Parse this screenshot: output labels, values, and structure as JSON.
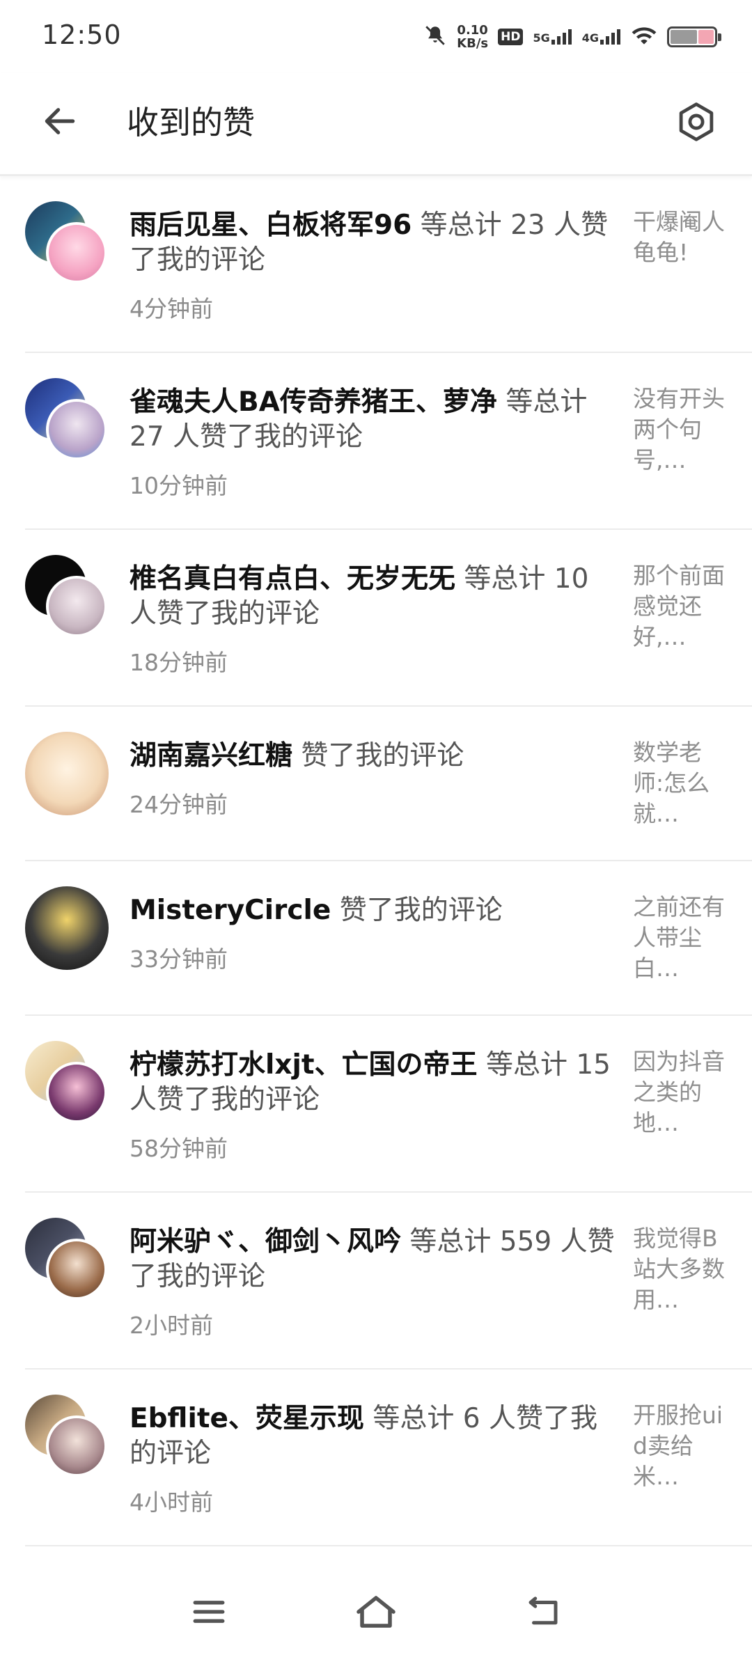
{
  "status": {
    "time": "12:50",
    "net_speed_value": "0.10",
    "net_speed_unit": "KB/s",
    "hd_label": "HD",
    "sig1_label": "5G",
    "sig2_label": "4G"
  },
  "header": {
    "title": "收到的赞"
  },
  "items": [
    {
      "names": "雨后见星、白板将军96",
      "action": " 等总计 23 人赞了我的评论",
      "time": "4分钟前",
      "preview": "干爆阉人龟龟!",
      "avatar_colors": [
        "#2e6b8a",
        "#f5a3c2"
      ]
    },
    {
      "names": "雀魂夫人BA传奇养猪王、萝净",
      "action": " 等总计 27 人赞了我的评论",
      "time": "10分钟前",
      "preview": "没有开头两个句号,…",
      "avatar_colors": [
        "#3b5bb5",
        "#b9a3c9"
      ]
    },
    {
      "names": "椎名真白有点白、无岁无旡",
      "action": " 等总计 10 人赞了我的评论",
      "time": "18分钟前",
      "preview": "那个前面感觉还好,…",
      "avatar_colors": [
        "#0a0a0a",
        "#c9b7c2"
      ]
    },
    {
      "names": "湖南嘉兴红糖",
      "action": " 赞了我的评论",
      "time": "24分钟前",
      "preview": "数学老师:怎么就…",
      "avatar_colors": [
        "#f3d8b7"
      ]
    },
    {
      "names": "MisteryCircle",
      "action": " 赞了我的评论",
      "time": "33分钟前",
      "preview": "之前还有人带尘白…",
      "avatar_colors": [
        "#1c1c1c"
      ]
    },
    {
      "names": "柠檬苏打水lxjt、亡国の帝王",
      "action": " 等总计 15 人赞了我的评论",
      "time": "58分钟前",
      "preview": "因为抖音之类的地…",
      "avatar_colors": [
        "#e8cfa0",
        "#7a3a6e"
      ]
    },
    {
      "names": "阿米驴ヾ、御剑丶风吟",
      "action": " 等总计 559 人赞了我的评论",
      "time": "2小时前",
      "preview": "我觉得B站大多数用…",
      "avatar_colors": [
        "#4a4f63",
        "#9a6b4a"
      ]
    },
    {
      "names": "Ebflite、荧星示现",
      "action": " 等总计 6 人赞了我的评论",
      "time": "4小时前",
      "preview": "开服抢uid卖给米…",
      "avatar_colors": [
        "#c7a982",
        "#a98a8e"
      ]
    }
  ],
  "nav": {
    "menu_icon": "menu-icon",
    "home_icon": "home-icon",
    "back_icon": "back-nav-icon"
  },
  "colors": {
    "names": "#111111",
    "secondary": "#8b8b8b",
    "divider": "#ebebeb"
  }
}
